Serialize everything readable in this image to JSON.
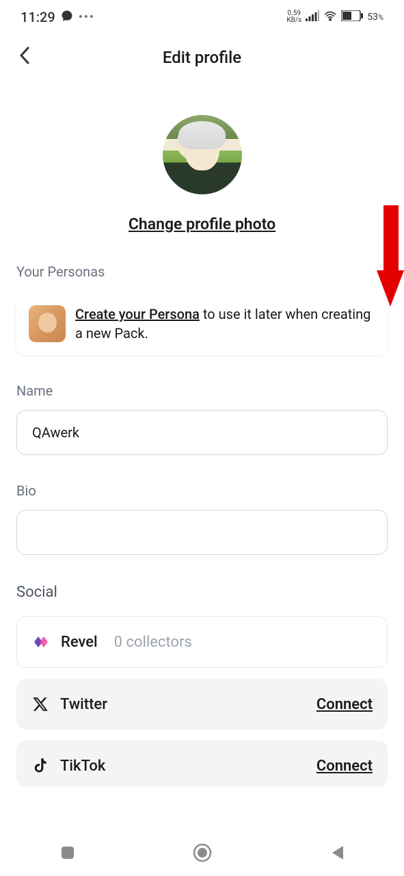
{
  "statusBar": {
    "time": "11:29",
    "kbsValue": "0.59",
    "kbsLabel": "KB/s",
    "battery": "53",
    "batteryUnit": "%"
  },
  "header": {
    "title": "Edit profile"
  },
  "profile": {
    "changePhotoLabel": "Change profile photo"
  },
  "personas": {
    "sectionLabel": "Your Personas",
    "createLink": "Create your Persona",
    "createSuffix": " to use it later when creating a new Pack."
  },
  "fields": {
    "nameLabel": "Name",
    "nameValue": "QAwerk",
    "bioLabel": "Bio",
    "bioValue": ""
  },
  "social": {
    "sectionLabel": "Social",
    "revel": {
      "name": "Revel",
      "collectors": "0 collectors"
    },
    "twitter": {
      "name": "Twitter",
      "action": "Connect"
    },
    "tiktok": {
      "name": "TikTok",
      "action": "Connect"
    }
  }
}
